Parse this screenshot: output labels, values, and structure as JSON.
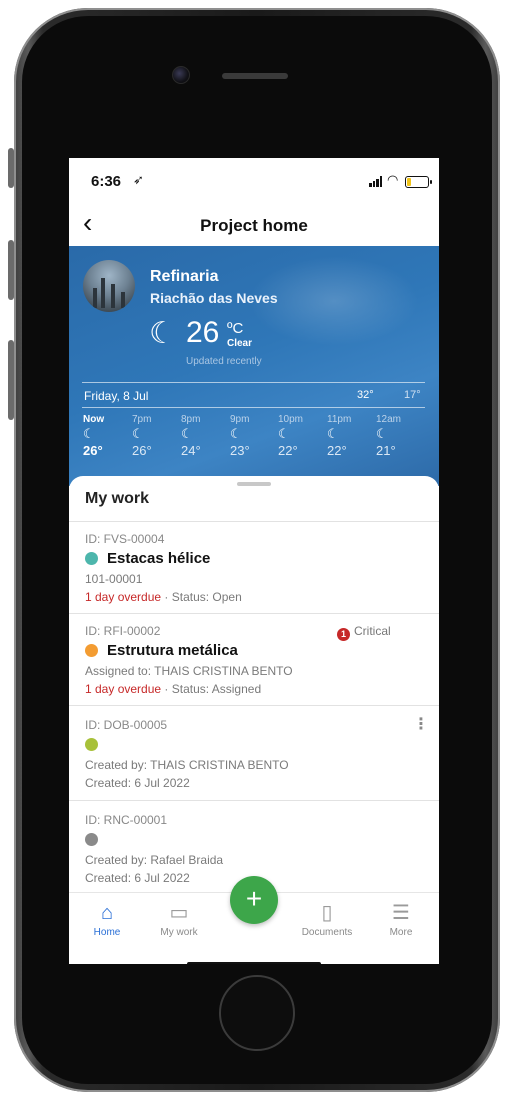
{
  "status_bar": {
    "time": "6:36",
    "location_icon": "location-arrow-icon"
  },
  "nav": {
    "back": "‹",
    "title": "Project home"
  },
  "project": {
    "name": "Refinaria",
    "location": "Riachão das Neves"
  },
  "current_weather": {
    "icon": "☾",
    "temperature": "26",
    "unit": "ºC",
    "condition": "Clear",
    "updated": "Updated recently"
  },
  "day": {
    "label": "Friday, 8 Jul",
    "high": "32°",
    "low": "17°"
  },
  "hourly": [
    {
      "label": "Now",
      "icon": "☾",
      "temp": "26°"
    },
    {
      "label": "7pm",
      "icon": "☾",
      "temp": "26°"
    },
    {
      "label": "8pm",
      "icon": "☾",
      "temp": "24°"
    },
    {
      "label": "9pm",
      "icon": "☾",
      "temp": "23°"
    },
    {
      "label": "10pm",
      "icon": "☾",
      "temp": "22°"
    },
    {
      "label": "11pm",
      "icon": "☾",
      "temp": "22°"
    },
    {
      "label": "12am",
      "icon": "☾",
      "temp": "21°"
    }
  ],
  "my_work": {
    "title": "My work",
    "items": [
      {
        "id": "ID: FVS-00004",
        "title": "Estacas hélice",
        "dot_color": "#4db6ac",
        "line1": "101-00001",
        "overdue": "1 day overdue",
        "status": " · Status: Open"
      },
      {
        "id": "ID: RFI-00002",
        "title": "Estrutura metálica",
        "dot_color": "#f39c32",
        "critical": "Critical",
        "critical_icon": "1",
        "line1": "Assigned to: THAIS CRISTINA BENTO",
        "overdue": "1 day overdue",
        "status": " · Status: Assigned"
      },
      {
        "id": "ID: DOB-00005",
        "dot_color": "#a8c13a",
        "line1": "Created by: THAIS CRISTINA BENTO",
        "line2": "Created: 6 Jul 2022",
        "menu": "⋮"
      },
      {
        "id": "ID: RNC-00001",
        "dot_color": "#8a8a8a",
        "line1": "Created by: Rafael Braida",
        "line2": "Created: 6 Jul 2022"
      }
    ]
  },
  "tabbar": {
    "home": "Home",
    "my_work": "My work",
    "add": "+",
    "documents": "Documents",
    "more": "More"
  }
}
